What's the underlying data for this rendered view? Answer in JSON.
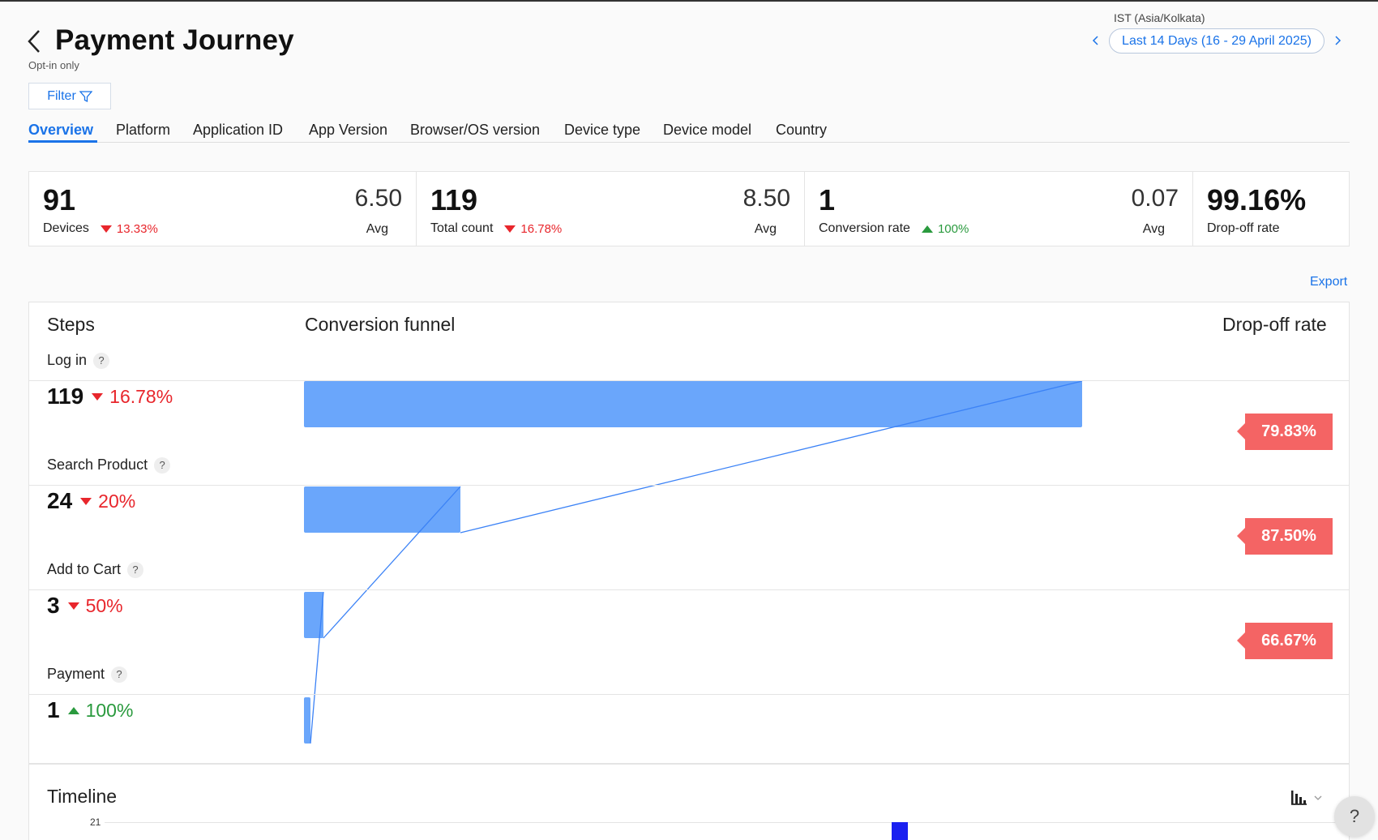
{
  "header": {
    "title": "Payment Journey",
    "subtitle": "Opt-in only",
    "filter_label": "Filter",
    "timezone": "IST (Asia/Kolkata)",
    "date_range": "Last 14 Days (16 - 29 April 2025)"
  },
  "tabs": [
    {
      "label": "Overview",
      "active": true
    },
    {
      "label": "Platform"
    },
    {
      "label": "Application ID"
    },
    {
      "label": "App Version"
    },
    {
      "label": "Browser/OS version"
    },
    {
      "label": "Device type"
    },
    {
      "label": "Device model"
    },
    {
      "label": "Country"
    }
  ],
  "kpis": [
    {
      "value": "91",
      "label": "Devices",
      "change": "13.33%",
      "direction": "down",
      "avg": "6.50",
      "avg_label": "Avg"
    },
    {
      "value": "119",
      "label": "Total count",
      "change": "16.78%",
      "direction": "down",
      "avg": "8.50",
      "avg_label": "Avg"
    },
    {
      "value": "1",
      "label": "Conversion rate",
      "change": "100%",
      "direction": "up",
      "avg": "0.07",
      "avg_label": "Avg"
    },
    {
      "value": "99.16%",
      "label": "Drop-off rate"
    }
  ],
  "export_label": "Export",
  "funnel": {
    "steps_header": "Steps",
    "funnel_header": "Conversion funnel",
    "dropoff_header": "Drop-off rate",
    "steps": [
      {
        "name": "Log in",
        "count": "119",
        "change": "16.78%",
        "direction": "down",
        "dropoff": "79.83%"
      },
      {
        "name": "Search Product",
        "count": "24",
        "change": "20%",
        "direction": "down",
        "dropoff": "87.50%"
      },
      {
        "name": "Add to Cart",
        "count": "3",
        "change": "50%",
        "direction": "down",
        "dropoff": "66.67%"
      },
      {
        "name": "Payment",
        "count": "1",
        "change": "100%",
        "direction": "up"
      }
    ],
    "help_glyph": "?"
  },
  "timeline": {
    "title": "Timeline",
    "y_tick": "21",
    "chart_icon": "bar-chart-icon",
    "help_glyph": "?"
  },
  "colors": {
    "accent": "#1a73e8",
    "funnel_bar": "#6aa6fb",
    "funnel_line": "#3b82f6",
    "dropoff_tag": "#f46464",
    "negative": "#e8262c",
    "positive": "#2a9a3e",
    "timeline_bar": "#1a20f0"
  }
}
